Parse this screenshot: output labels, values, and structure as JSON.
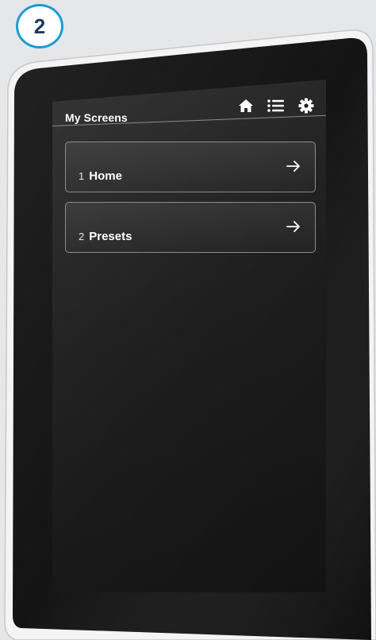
{
  "step": {
    "number": "2"
  },
  "header": {
    "title": "My Screens",
    "icons": [
      "home-icon",
      "list-icon",
      "gear-icon"
    ]
  },
  "screens": [
    {
      "index": "1",
      "name": "Home"
    },
    {
      "index": "2",
      "name": "Presets"
    }
  ],
  "colors": {
    "badge_border": "#1d9ad6",
    "badge_text": "#1b3a5c",
    "screen_bg": "#1e1e1f",
    "bezel": "#141414",
    "item_border": "#8c8c8c",
    "text": "#ffffff"
  }
}
